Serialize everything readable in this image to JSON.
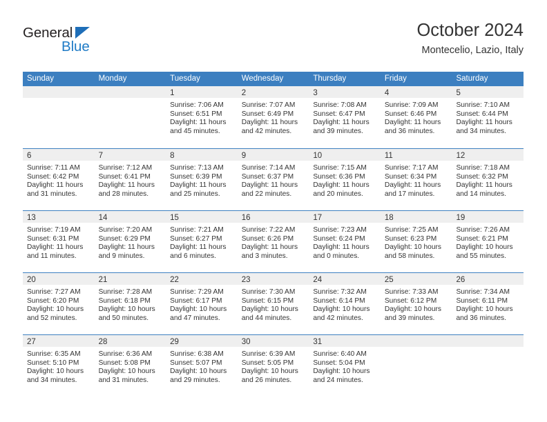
{
  "brand": {
    "name_part1": "General",
    "name_part2": "Blue",
    "triangle_color": "#1e6eb8",
    "blue_color": "#1f7bc6"
  },
  "header": {
    "title": "October 2024",
    "subtitle": "Montecelio, Lazio, Italy"
  },
  "colors": {
    "header_blue": "#3c7fc0",
    "day_band_gray": "#efefef",
    "text": "#333333"
  },
  "weekdays": [
    "Sunday",
    "Monday",
    "Tuesday",
    "Wednesday",
    "Thursday",
    "Friday",
    "Saturday"
  ],
  "weeks": [
    [
      {
        "day": "",
        "lines": []
      },
      {
        "day": "",
        "lines": []
      },
      {
        "day": "1",
        "lines": [
          "Sunrise: 7:06 AM",
          "Sunset: 6:51 PM",
          "Daylight: 11 hours",
          "and 45 minutes."
        ]
      },
      {
        "day": "2",
        "lines": [
          "Sunrise: 7:07 AM",
          "Sunset: 6:49 PM",
          "Daylight: 11 hours",
          "and 42 minutes."
        ]
      },
      {
        "day": "3",
        "lines": [
          "Sunrise: 7:08 AM",
          "Sunset: 6:47 PM",
          "Daylight: 11 hours",
          "and 39 minutes."
        ]
      },
      {
        "day": "4",
        "lines": [
          "Sunrise: 7:09 AM",
          "Sunset: 6:46 PM",
          "Daylight: 11 hours",
          "and 36 minutes."
        ]
      },
      {
        "day": "5",
        "lines": [
          "Sunrise: 7:10 AM",
          "Sunset: 6:44 PM",
          "Daylight: 11 hours",
          "and 34 minutes."
        ]
      }
    ],
    [
      {
        "day": "6",
        "lines": [
          "Sunrise: 7:11 AM",
          "Sunset: 6:42 PM",
          "Daylight: 11 hours",
          "and 31 minutes."
        ]
      },
      {
        "day": "7",
        "lines": [
          "Sunrise: 7:12 AM",
          "Sunset: 6:41 PM",
          "Daylight: 11 hours",
          "and 28 minutes."
        ]
      },
      {
        "day": "8",
        "lines": [
          "Sunrise: 7:13 AM",
          "Sunset: 6:39 PM",
          "Daylight: 11 hours",
          "and 25 minutes."
        ]
      },
      {
        "day": "9",
        "lines": [
          "Sunrise: 7:14 AM",
          "Sunset: 6:37 PM",
          "Daylight: 11 hours",
          "and 22 minutes."
        ]
      },
      {
        "day": "10",
        "lines": [
          "Sunrise: 7:15 AM",
          "Sunset: 6:36 PM",
          "Daylight: 11 hours",
          "and 20 minutes."
        ]
      },
      {
        "day": "11",
        "lines": [
          "Sunrise: 7:17 AM",
          "Sunset: 6:34 PM",
          "Daylight: 11 hours",
          "and 17 minutes."
        ]
      },
      {
        "day": "12",
        "lines": [
          "Sunrise: 7:18 AM",
          "Sunset: 6:32 PM",
          "Daylight: 11 hours",
          "and 14 minutes."
        ]
      }
    ],
    [
      {
        "day": "13",
        "lines": [
          "Sunrise: 7:19 AM",
          "Sunset: 6:31 PM",
          "Daylight: 11 hours",
          "and 11 minutes."
        ]
      },
      {
        "day": "14",
        "lines": [
          "Sunrise: 7:20 AM",
          "Sunset: 6:29 PM",
          "Daylight: 11 hours",
          "and 9 minutes."
        ]
      },
      {
        "day": "15",
        "lines": [
          "Sunrise: 7:21 AM",
          "Sunset: 6:27 PM",
          "Daylight: 11 hours",
          "and 6 minutes."
        ]
      },
      {
        "day": "16",
        "lines": [
          "Sunrise: 7:22 AM",
          "Sunset: 6:26 PM",
          "Daylight: 11 hours",
          "and 3 minutes."
        ]
      },
      {
        "day": "17",
        "lines": [
          "Sunrise: 7:23 AM",
          "Sunset: 6:24 PM",
          "Daylight: 11 hours",
          "and 0 minutes."
        ]
      },
      {
        "day": "18",
        "lines": [
          "Sunrise: 7:25 AM",
          "Sunset: 6:23 PM",
          "Daylight: 10 hours",
          "and 58 minutes."
        ]
      },
      {
        "day": "19",
        "lines": [
          "Sunrise: 7:26 AM",
          "Sunset: 6:21 PM",
          "Daylight: 10 hours",
          "and 55 minutes."
        ]
      }
    ],
    [
      {
        "day": "20",
        "lines": [
          "Sunrise: 7:27 AM",
          "Sunset: 6:20 PM",
          "Daylight: 10 hours",
          "and 52 minutes."
        ]
      },
      {
        "day": "21",
        "lines": [
          "Sunrise: 7:28 AM",
          "Sunset: 6:18 PM",
          "Daylight: 10 hours",
          "and 50 minutes."
        ]
      },
      {
        "day": "22",
        "lines": [
          "Sunrise: 7:29 AM",
          "Sunset: 6:17 PM",
          "Daylight: 10 hours",
          "and 47 minutes."
        ]
      },
      {
        "day": "23",
        "lines": [
          "Sunrise: 7:30 AM",
          "Sunset: 6:15 PM",
          "Daylight: 10 hours",
          "and 44 minutes."
        ]
      },
      {
        "day": "24",
        "lines": [
          "Sunrise: 7:32 AM",
          "Sunset: 6:14 PM",
          "Daylight: 10 hours",
          "and 42 minutes."
        ]
      },
      {
        "day": "25",
        "lines": [
          "Sunrise: 7:33 AM",
          "Sunset: 6:12 PM",
          "Daylight: 10 hours",
          "and 39 minutes."
        ]
      },
      {
        "day": "26",
        "lines": [
          "Sunrise: 7:34 AM",
          "Sunset: 6:11 PM",
          "Daylight: 10 hours",
          "and 36 minutes."
        ]
      }
    ],
    [
      {
        "day": "27",
        "lines": [
          "Sunrise: 6:35 AM",
          "Sunset: 5:10 PM",
          "Daylight: 10 hours",
          "and 34 minutes."
        ]
      },
      {
        "day": "28",
        "lines": [
          "Sunrise: 6:36 AM",
          "Sunset: 5:08 PM",
          "Daylight: 10 hours",
          "and 31 minutes."
        ]
      },
      {
        "day": "29",
        "lines": [
          "Sunrise: 6:38 AM",
          "Sunset: 5:07 PM",
          "Daylight: 10 hours",
          "and 29 minutes."
        ]
      },
      {
        "day": "30",
        "lines": [
          "Sunrise: 6:39 AM",
          "Sunset: 5:05 PM",
          "Daylight: 10 hours",
          "and 26 minutes."
        ]
      },
      {
        "day": "31",
        "lines": [
          "Sunrise: 6:40 AM",
          "Sunset: 5:04 PM",
          "Daylight: 10 hours",
          "and 24 minutes."
        ]
      },
      {
        "day": "",
        "lines": []
      },
      {
        "day": "",
        "lines": []
      }
    ]
  ]
}
